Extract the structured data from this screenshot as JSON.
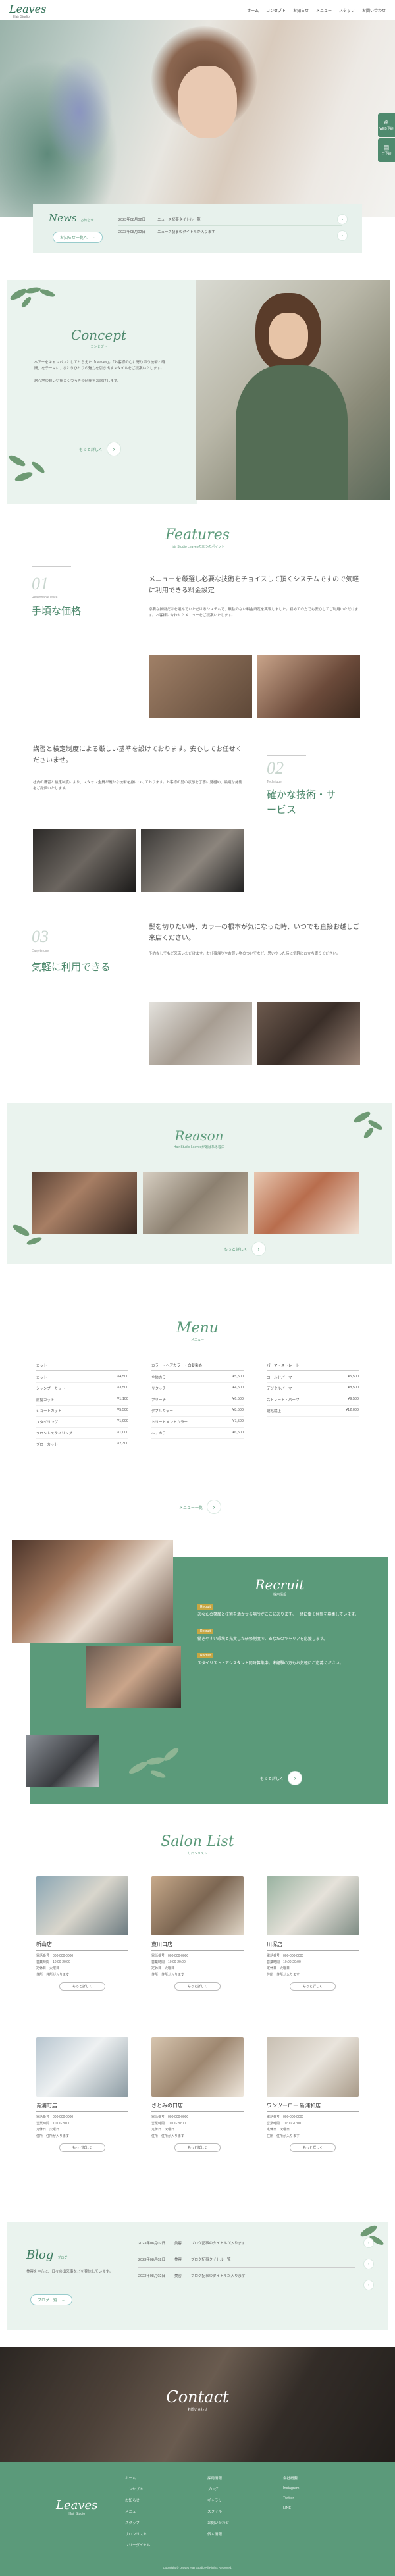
{
  "header": {
    "logo": "Leaves",
    "logo_sub": "Hair Studio",
    "nav": [
      "ホーム",
      "コンセプト",
      "お知らせ",
      "メニュー",
      "スタッフ",
      "お問い合わせ"
    ]
  },
  "side_buttons": [
    {
      "label": "WEB予約"
    },
    {
      "label": "ご予約"
    }
  ],
  "news": {
    "title": "News",
    "sub": "お知らせ",
    "more": "お知らせ一覧へ",
    "items": [
      {
        "date": "2023年08月02日",
        "text": "ニュース記事タイトル一覧"
      },
      {
        "date": "2023年08月02日",
        "text": "ニュース記事のタイトルが入ります"
      }
    ]
  },
  "concept": {
    "title": "Concept",
    "sub": "コンセプト",
    "body1": "ヘアーをキャンバスとしてとらえた「Leaves」。「お客様の心に寄り添う技術と時間」をテーマに、ひとりひとりの魅力を引き出すスタイルをご提案いたします。",
    "body2": "居心地の良い空間とくつろぎの時間をお届けします。",
    "more": "もっと詳しく"
  },
  "features": {
    "title": "Features",
    "sub": "Hair Studio Leavesの三つのポイント",
    "items": [
      {
        "num": "01",
        "en": "Reasonable Price",
        "jp": "手頃な価格",
        "lead": "メニューを厳選し必要な技術をチョイスして頂くシステムですので気軽に利用できる料金設定",
        "body": "必要な技術だけを選んでいただけるシステムで、無駄のない料金設定を実現しました。初めての方でも安心してご利用いただけます。お客様に合わせたメニューをご提案いたします。"
      },
      {
        "num": "02",
        "en": "Technique",
        "jp": "確かな技術・サービス",
        "lead": "講習と検定制度による厳しい基準を設けております。安心してお任せくださいませ。",
        "body": "社内の講習と検定制度により、スタッフ全員が確かな技術を身につけております。お客様の髪の状態を丁寧に見極め、最適な施術をご提供いたします。"
      },
      {
        "num": "03",
        "en": "Easy to use",
        "jp": "気軽に利用できる",
        "lead": "髪を切りたい時、カラーの根本が気になった時、いつでも直接お越しご来店ください。",
        "body": "予約なしでもご来店いただけます。お仕事帰りやお買い物のついでなど、思い立った時に気軽にお立ち寄りください。"
      }
    ]
  },
  "reason": {
    "title": "Reason",
    "sub": "Hair Studio Leavesが選ばれる理由",
    "more": "もっと詳しく"
  },
  "menu": {
    "title": "Menu",
    "sub": "メニュー",
    "more": "メニュー一覧",
    "cols": [
      {
        "head": "カット",
        "rows": [
          [
            "カット",
            "¥4,500"
          ],
          [
            "シャンプーカット",
            "¥3,500"
          ],
          [
            "前髪カット",
            "¥1,100"
          ],
          [
            "ショートカット",
            "¥5,500"
          ],
          [
            "スタイリング",
            "¥1,000"
          ],
          [
            "フロントスタイリング",
            "¥1,000"
          ],
          [
            "ブローカット",
            "¥2,300"
          ]
        ]
      },
      {
        "head": "カラー・ヘアカラー・白髪染め",
        "rows": [
          [
            "全体カラー",
            "¥5,500"
          ],
          [
            "リタッチ",
            "¥4,500"
          ],
          [
            "ブリーチ",
            "¥6,500"
          ],
          [
            "ダブルカラー",
            "¥8,500"
          ],
          [
            "トリートメントカラー",
            "¥7,500"
          ],
          [
            "ヘナカラー",
            "¥6,500"
          ],
          [
            "",
            ""
          ]
        ]
      },
      {
        "head": "パーマ・ストレート",
        "rows": [
          [
            "コールドパーマ",
            "¥5,500"
          ],
          [
            "デジタルパーマ",
            "¥8,500"
          ],
          [
            "ストレート・パーマ",
            "¥9,500"
          ],
          [
            "縮毛矯正",
            "¥12,000"
          ],
          [
            "",
            ""
          ]
        ]
      }
    ]
  },
  "recruit": {
    "title": "Recruit",
    "sub": "採用情報",
    "tags": [
      "Recruit",
      "Recruit",
      "Recruit"
    ],
    "blocks": [
      "あなたの笑顔と技術を活かせる場所がここにあります。一緒に働く仲間を募集しています。",
      "働きやすい環境と充実した研修制度で、あなたのキャリアを応援します。",
      "スタイリスト・アシスタント同時募集中。未経験の方もお気軽にご応募ください。"
    ],
    "more": "もっと詳しく"
  },
  "salons": {
    "title": "Salon List",
    "sub": "サロンリスト",
    "more": "もっと詳しく",
    "items": [
      {
        "name": "新山店",
        "tel": "000-000-0000",
        "hours": "10:00-20:00",
        "holiday": "火曜日",
        "addr": "住所が入ります"
      },
      {
        "name": "東川口店",
        "tel": "000-000-0000",
        "hours": "10:00-20:00",
        "holiday": "火曜日",
        "addr": "住所が入ります"
      },
      {
        "name": "川塚店",
        "tel": "000-000-0000",
        "hours": "10:00-20:00",
        "holiday": "火曜日",
        "addr": "住所が入ります"
      },
      {
        "name": "青浦町店",
        "tel": "000-000-0000",
        "hours": "10:00-20:00",
        "holiday": "火曜日",
        "addr": "住所が入ります"
      },
      {
        "name": "さとみの口店",
        "tel": "000-000-0000",
        "hours": "10:00-20:00",
        "holiday": "火曜日",
        "addr": "住所が入ります"
      },
      {
        "name": "ワンツーロー 新浦和店",
        "tel": "000-000-0000",
        "hours": "10:00-20:00",
        "holiday": "火曜日",
        "addr": "住所が入ります"
      }
    ],
    "labels": {
      "tel": "電話番号",
      "hours": "営業時間",
      "holiday": "定休日",
      "addr": "住所"
    }
  },
  "blog": {
    "title": "Blog",
    "sub": "ブログ",
    "intro": "美容を中心に、日々の出来事などを発信しています。",
    "more": "ブログ一覧",
    "items": [
      {
        "date": "2023年08月02日",
        "cat": "美容",
        "text": "ブログ記事のタイトルが入ります"
      },
      {
        "date": "2023年08月02日",
        "cat": "美容",
        "text": "ブログ記事タイトル一覧"
      },
      {
        "date": "2023年08月02日",
        "cat": "美容",
        "text": "ブログ記事のタイトルが入ります"
      }
    ]
  },
  "contact": {
    "title": "Contact",
    "sub": "お問い合わせ"
  },
  "footer": {
    "logo": "Leaves",
    "logo_sub": "Hair Studio",
    "col1": [
      "ホーム",
      "コンセプト",
      "お知らせ",
      "メニュー",
      "スタッフ",
      "サロンリスト",
      "フリーダイヤル"
    ],
    "col2": [
      "採用情報",
      "ブログ",
      "ギャラリー",
      "スタイル",
      "お問い合わせ",
      "個人情報"
    ],
    "col3": [
      "会社概要",
      "Instagram",
      "Twitter",
      "LINE"
    ],
    "copy": "Copyright © Leaves Hair Studio All Rights Reserved."
  }
}
